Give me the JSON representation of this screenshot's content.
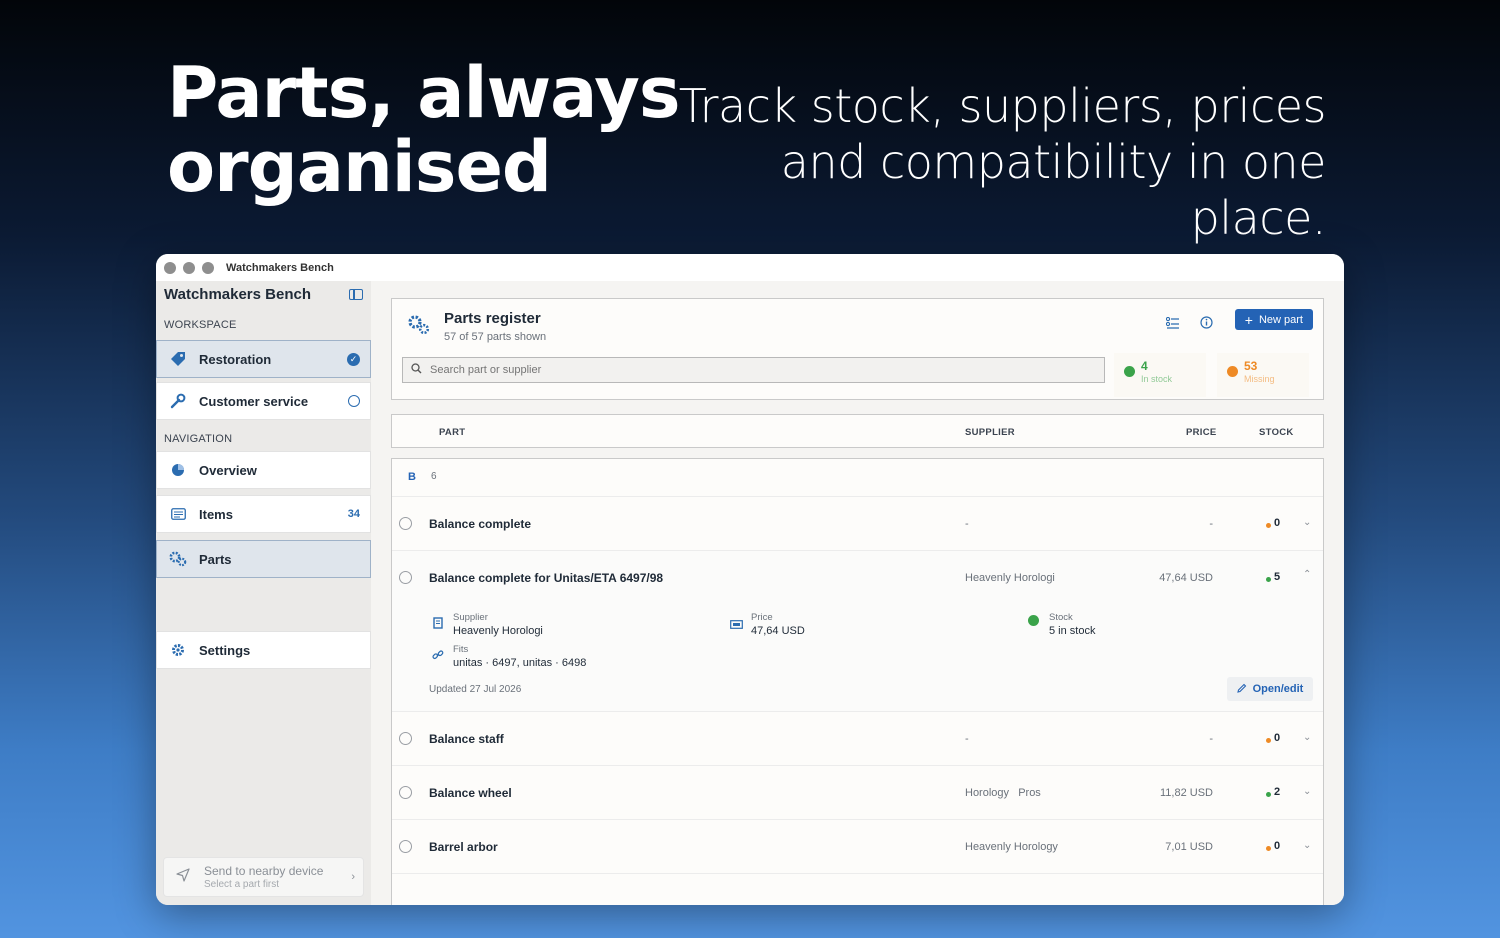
{
  "hero": {
    "title_line1": "Parts, always",
    "title_line2": "organised",
    "subtitle_line1": "Track stock, suppliers, prices",
    "subtitle_line2": "and compatibility in one place."
  },
  "window": {
    "title": "Watchmakers Bench"
  },
  "sidebar": {
    "app_name": "Watchmakers Bench",
    "workspace_label": "WORKSPACE",
    "workspace_items": [
      {
        "label": "Restoration",
        "icon": "tag-icon",
        "selected": true
      },
      {
        "label": "Customer service",
        "icon": "wrench-icon",
        "selected": false
      }
    ],
    "navigation_label": "NAVIGATION",
    "nav_items": [
      {
        "label": "Overview",
        "icon": "pie-chart-icon"
      },
      {
        "label": "Items",
        "icon": "list-icon",
        "count": "34"
      },
      {
        "label": "Parts",
        "icon": "gears-icon"
      },
      {
        "label": "Settings",
        "icon": "gear-icon"
      }
    ],
    "send": {
      "title": "Send to nearby device",
      "subtitle": "Select a part first"
    }
  },
  "register": {
    "title": "Parts register",
    "subtitle": "57 of 57 parts shown",
    "new_part_label": "New part",
    "search_placeholder": "Search part or supplier",
    "stats": [
      {
        "value": "4",
        "label": "In stock",
        "color": "#3aa34a"
      },
      {
        "value": "53",
        "label": "Missing",
        "color": "#ee8a25"
      }
    ]
  },
  "columns": {
    "part": "PART",
    "supplier": "SUPPLIER",
    "price": "PRICE",
    "stock": "STOCK"
  },
  "group": {
    "letter": "B",
    "count": "6"
  },
  "rows": [
    {
      "name": "Balance complete",
      "supplier": "-",
      "price": "-",
      "stock": "0",
      "status_color": "#ee8a25"
    },
    {
      "name": "Balance complete for Unitas/ETA 6497/98",
      "supplier": "Heavenly Horologi",
      "price": "47,64 USD",
      "stock": "5",
      "status_color": "#3aa34a"
    },
    {
      "name": "Balance staff",
      "supplier": "-",
      "price": "-",
      "stock": "0",
      "status_color": "#ee8a25"
    },
    {
      "name": "Balance wheel",
      "supplier": "Horology   Pros",
      "price": "11,82 USD",
      "stock": "2",
      "status_color": "#3aa34a"
    },
    {
      "name": "Barrel arbor",
      "supplier": "Heavenly Horology",
      "price": "7,01 USD",
      "stock": "0",
      "status_color": "#ee8a25"
    }
  ],
  "detail": {
    "supplier_label": "Supplier",
    "supplier_value": "Heavenly Horologi",
    "price_label": "Price",
    "price_value": "47,64 USD",
    "stock_label": "Stock",
    "stock_value": "5 in stock",
    "fits_label": "Fits",
    "fits_value": "unitas · 6497, unitas · 6498",
    "updated": "Updated 27 Jul 2026",
    "open_edit_label": "Open/edit"
  },
  "colors": {
    "accent": "#2463b5",
    "in_stock": "#3aa34a",
    "missing": "#ee8a25"
  }
}
